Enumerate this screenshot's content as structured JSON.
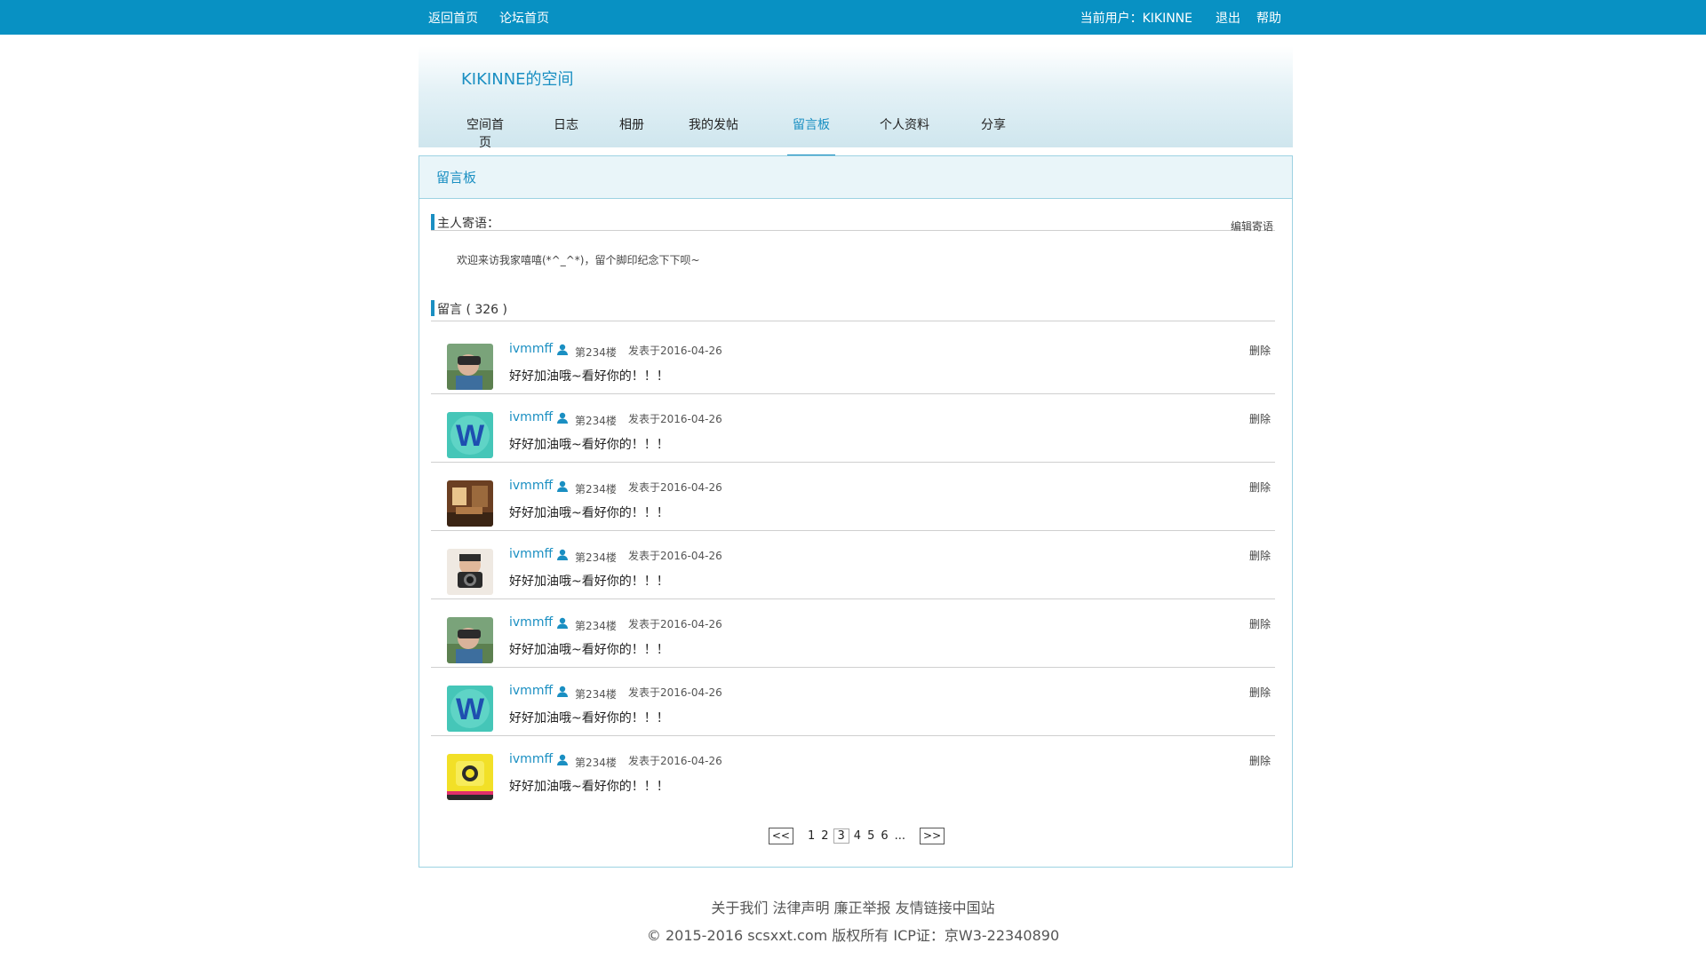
{
  "topbar": {
    "left_links": [
      "返回首页",
      "论坛首页"
    ],
    "current_user": "当前用户：KIKINNE",
    "logout": "退出",
    "help": "帮助"
  },
  "header": {
    "space_title": "KIKINNE的空间",
    "tabs": [
      "空间首页",
      "日志",
      "相册",
      "我的发帖",
      "留言板",
      "个人资料",
      "分享"
    ],
    "active_tab": "留言板"
  },
  "panel": {
    "title": "留言板",
    "owner_section": {
      "title": "主人寄语：",
      "edit_label": "编辑寄语",
      "motto": "欢迎来访我家嘻嘻(*^_^*)，留个脚印纪念下下呗~"
    },
    "messages_section": {
      "title": "留言 ( 326 )"
    },
    "messages": [
      {
        "user": "ivmmff",
        "floor": "第234楼",
        "date": "发表于2016-04-26",
        "text": "好好加油哦~看好你的！！！",
        "delete": "删除",
        "avatar": "vr-man"
      },
      {
        "user": "ivmmff",
        "floor": "第234楼",
        "date": "发表于2016-04-26",
        "text": "好好加油哦~看好你的！！！",
        "delete": "删除",
        "avatar": "w-logo"
      },
      {
        "user": "ivmmff",
        "floor": "第234楼",
        "date": "发表于2016-04-26",
        "text": "好好加油哦~看好你的！！！",
        "delete": "删除",
        "avatar": "room"
      },
      {
        "user": "ivmmff",
        "floor": "第234楼",
        "date": "发表于2016-04-26",
        "text": "好好加油哦~看好你的！！！",
        "delete": "删除",
        "avatar": "camera-man"
      },
      {
        "user": "ivmmff",
        "floor": "第234楼",
        "date": "发表于2016-04-26",
        "text": "好好加油哦~看好你的！！！",
        "delete": "删除",
        "avatar": "vr-man"
      },
      {
        "user": "ivmmff",
        "floor": "第234楼",
        "date": "发表于2016-04-26",
        "text": "好好加油哦~看好你的！！！",
        "delete": "删除",
        "avatar": "w-logo"
      },
      {
        "user": "ivmmff",
        "floor": "第234楼",
        "date": "发表于2016-04-26",
        "text": "好好加油哦~看好你的！！！",
        "delete": "删除",
        "avatar": "yellow-camera"
      }
    ],
    "pager": {
      "prev": "<<",
      "next": ">>",
      "pages": [
        "1",
        "2",
        "3",
        "4",
        "5",
        "6"
      ],
      "current": "3",
      "ellipsis": "..."
    }
  },
  "footer": {
    "links": [
      "关于我们",
      "法律声明",
      "廉正举报",
      "友情链接中国站"
    ],
    "copyright": "© 2015-2016 scsxxt.com 版权所有 ICP证：京W3-22340890"
  },
  "colors": {
    "topbar": "#0891c3",
    "accent": "#1a8fc2",
    "border": "#9dd2e2"
  }
}
